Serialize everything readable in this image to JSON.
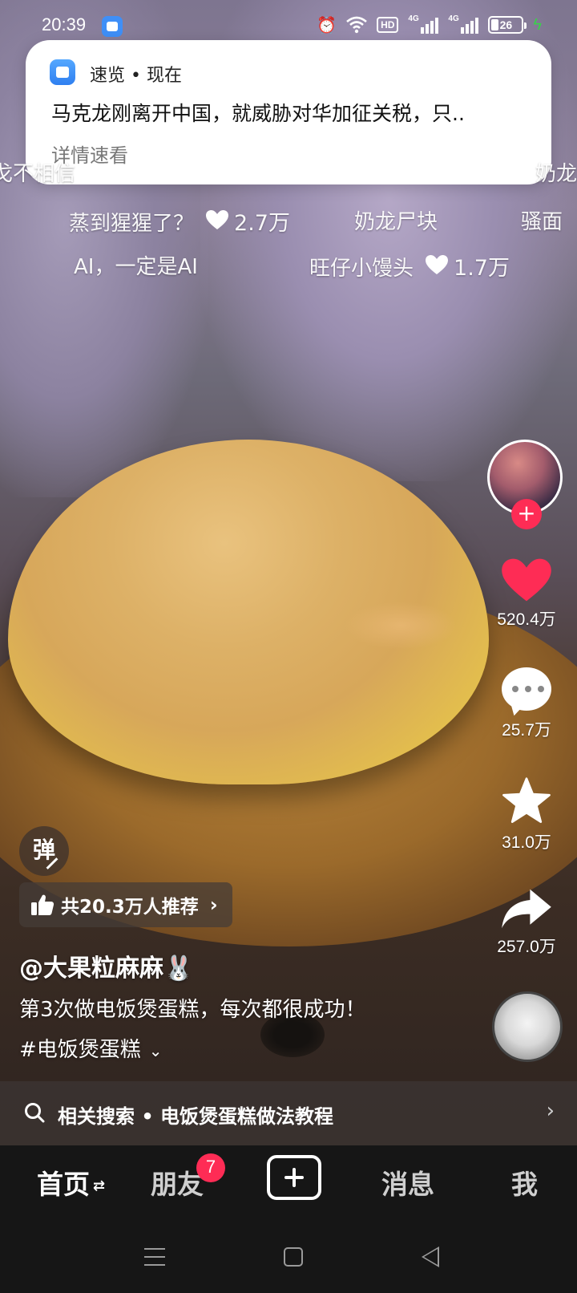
{
  "status_bar": {
    "time": "20:39",
    "hd_label": "HD",
    "sim1_label": "4G",
    "sim2_label": "4G",
    "battery": "26",
    "battery_level": 0.26
  },
  "notification": {
    "app_name": "速览",
    "separator": " • ",
    "when": "现在",
    "body": "马克龙刚离开中国，就威胁对华加征关税，只..",
    "action": "详情速看"
  },
  "danmaku": {
    "row1": [
      "戈不相信",
      "奶龙"
    ],
    "row2": [
      {
        "text": "蒸到猩猩了？",
        "likes": "2.7万"
      },
      {
        "text": "奶龙尸块"
      },
      {
        "text": "骚面"
      }
    ],
    "row3": [
      {
        "text": "AI，一定是AI"
      },
      {
        "text": "旺仔小馒头",
        "likes": "1.7万"
      }
    ]
  },
  "actions": {
    "follow": "+",
    "likes": "520.4万",
    "comments": "25.7万",
    "favorites": "31.0万",
    "shares": "257.0万"
  },
  "info": {
    "danmu_toggle": "弹",
    "recommend": "共20.3万人推荐",
    "author": "@大果粒麻麻🐰",
    "description": "第3次做电饭煲蛋糕，每次都很成功！",
    "hashtag": "#电饭煲蛋糕"
  },
  "related_search": {
    "text": "相关搜索 • 电饭煲蛋糕做法教程"
  },
  "bottom_nav": {
    "home": "首页",
    "friends": "朋友",
    "friends_badge": "7",
    "messages": "消息",
    "me": "我"
  },
  "colors": {
    "accent": "#fe2c55",
    "nav_bg": "#161616",
    "charging": "#39d24a"
  }
}
